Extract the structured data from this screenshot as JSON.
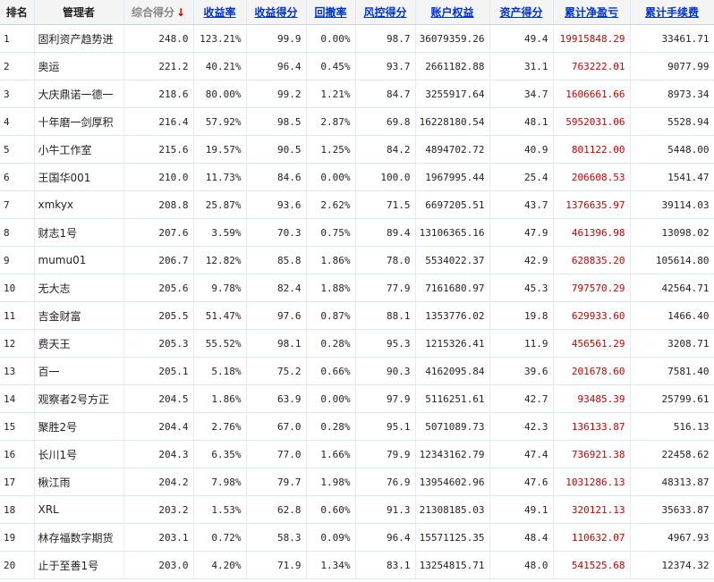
{
  "table": {
    "headers": [
      {
        "label": "排名",
        "key": "rank"
      },
      {
        "label": "管理者",
        "key": "manager"
      },
      {
        "label": "综合得分",
        "key": "composite",
        "sorted": true,
        "sort_arrow": "↓"
      },
      {
        "label": "收益率",
        "key": "return_rate"
      },
      {
        "label": "收益得分",
        "key": "return_score"
      },
      {
        "label": "回撤率",
        "key": "drawdown"
      },
      {
        "label": "风控得分",
        "key": "risk_score"
      },
      {
        "label": "账户权益",
        "key": "equity"
      },
      {
        "label": "资产得分",
        "key": "asset_score"
      },
      {
        "label": "累计净盈亏",
        "key": "net_pl"
      },
      {
        "label": "累计手续费",
        "key": "fees"
      }
    ],
    "rows": [
      {
        "rank": "1",
        "manager": "固利资产趋势进",
        "composite": "248.0",
        "return_rate": "123.21%",
        "return_score": "99.9",
        "drawdown": "0.00%",
        "risk_score": "98.7",
        "equity": "36079359.26",
        "asset_score": "49.4",
        "net_pl": "19915848.29",
        "fees": "33461.71"
      },
      {
        "rank": "2",
        "manager": "奥运",
        "composite": "221.2",
        "return_rate": "40.21%",
        "return_score": "96.4",
        "drawdown": "0.45%",
        "risk_score": "93.7",
        "equity": "2661182.88",
        "asset_score": "31.1",
        "net_pl": "763222.01",
        "fees": "9077.99"
      },
      {
        "rank": "3",
        "manager": "大庆鼎诺一德一",
        "composite": "218.6",
        "return_rate": "80.00%",
        "return_score": "99.2",
        "drawdown": "1.21%",
        "risk_score": "84.7",
        "equity": "3255917.64",
        "asset_score": "34.7",
        "net_pl": "1606661.66",
        "fees": "8973.34"
      },
      {
        "rank": "4",
        "manager": "十年磨一剑厚积",
        "composite": "216.4",
        "return_rate": "57.92%",
        "return_score": "98.5",
        "drawdown": "2.87%",
        "risk_score": "69.8",
        "equity": "16228180.54",
        "asset_score": "48.1",
        "net_pl": "5952031.06",
        "fees": "5528.94"
      },
      {
        "rank": "5",
        "manager": "小牛工作室",
        "composite": "215.6",
        "return_rate": "19.57%",
        "return_score": "90.5",
        "drawdown": "1.25%",
        "risk_score": "84.2",
        "equity": "4894702.72",
        "asset_score": "40.9",
        "net_pl": "801122.00",
        "fees": "5448.00"
      },
      {
        "rank": "6",
        "manager": "王国华001",
        "composite": "210.0",
        "return_rate": "11.73%",
        "return_score": "84.6",
        "drawdown": "0.00%",
        "risk_score": "100.0",
        "equity": "1967995.44",
        "asset_score": "25.4",
        "net_pl": "206608.53",
        "fees": "1541.47"
      },
      {
        "rank": "7",
        "manager": "xmkyx",
        "composite": "208.8",
        "return_rate": "25.87%",
        "return_score": "93.6",
        "drawdown": "2.62%",
        "risk_score": "71.5",
        "equity": "6697205.51",
        "asset_score": "43.7",
        "net_pl": "1376635.97",
        "fees": "39114.03"
      },
      {
        "rank": "8",
        "manager": "财志1号",
        "composite": "207.6",
        "return_rate": "3.59%",
        "return_score": "70.3",
        "drawdown": "0.75%",
        "risk_score": "89.4",
        "equity": "13106365.16",
        "asset_score": "47.9",
        "net_pl": "461396.98",
        "fees": "13098.02"
      },
      {
        "rank": "9",
        "manager": "mumu01",
        "composite": "206.7",
        "return_rate": "12.82%",
        "return_score": "85.8",
        "drawdown": "1.86%",
        "risk_score": "78.0",
        "equity": "5534022.37",
        "asset_score": "42.9",
        "net_pl": "628835.20",
        "fees": "105614.80"
      },
      {
        "rank": "10",
        "manager": "无大志",
        "composite": "205.6",
        "return_rate": "9.78%",
        "return_score": "82.4",
        "drawdown": "1.88%",
        "risk_score": "77.9",
        "equity": "7161680.97",
        "asset_score": "45.3",
        "net_pl": "797570.29",
        "fees": "42564.71"
      },
      {
        "rank": "11",
        "manager": "吉金财富",
        "composite": "205.5",
        "return_rate": "51.47%",
        "return_score": "97.6",
        "drawdown": "0.87%",
        "risk_score": "88.1",
        "equity": "1353776.02",
        "asset_score": "19.8",
        "net_pl": "629933.60",
        "fees": "1466.40"
      },
      {
        "rank": "12",
        "manager": "费天王",
        "composite": "205.3",
        "return_rate": "55.52%",
        "return_score": "98.1",
        "drawdown": "0.28%",
        "risk_score": "95.3",
        "equity": "1215326.41",
        "asset_score": "11.9",
        "net_pl": "456561.29",
        "fees": "3208.71"
      },
      {
        "rank": "13",
        "manager": "百一",
        "composite": "205.1",
        "return_rate": "5.18%",
        "return_score": "75.2",
        "drawdown": "0.66%",
        "risk_score": "90.3",
        "equity": "4162095.84",
        "asset_score": "39.6",
        "net_pl": "201678.60",
        "fees": "7581.40"
      },
      {
        "rank": "14",
        "manager": "观察者2号方正",
        "composite": "204.5",
        "return_rate": "1.86%",
        "return_score": "63.9",
        "drawdown": "0.00%",
        "risk_score": "97.9",
        "equity": "5116251.61",
        "asset_score": "42.7",
        "net_pl": "93485.39",
        "fees": "25799.61"
      },
      {
        "rank": "15",
        "manager": "聚胜2号",
        "composite": "204.4",
        "return_rate": "2.76%",
        "return_score": "67.0",
        "drawdown": "0.28%",
        "risk_score": "95.1",
        "equity": "5071089.73",
        "asset_score": "42.3",
        "net_pl": "136133.87",
        "fees": "516.13"
      },
      {
        "rank": "16",
        "manager": "长川1号",
        "composite": "204.3",
        "return_rate": "6.35%",
        "return_score": "77.0",
        "drawdown": "1.66%",
        "risk_score": "79.9",
        "equity": "12343162.79",
        "asset_score": "47.4",
        "net_pl": "736921.38",
        "fees": "22458.62"
      },
      {
        "rank": "17",
        "manager": "楸江雨",
        "composite": "204.2",
        "return_rate": "7.98%",
        "return_score": "79.7",
        "drawdown": "1.98%",
        "risk_score": "76.9",
        "equity": "13954602.96",
        "asset_score": "47.6",
        "net_pl": "1031286.13",
        "fees": "48313.87"
      },
      {
        "rank": "18",
        "manager": "XRL",
        "composite": "203.2",
        "return_rate": "1.53%",
        "return_score": "62.8",
        "drawdown": "0.60%",
        "risk_score": "91.3",
        "equity": "21308185.03",
        "asset_score": "49.1",
        "net_pl": "320121.13",
        "fees": "35633.87"
      },
      {
        "rank": "19",
        "manager": "林存福数字期货",
        "composite": "203.1",
        "return_rate": "0.72%",
        "return_score": "58.3",
        "drawdown": "0.09%",
        "risk_score": "96.4",
        "equity": "15571125.35",
        "asset_score": "48.4",
        "net_pl": "110632.07",
        "fees": "4967.93"
      },
      {
        "rank": "20",
        "manager": "止于至善1号",
        "composite": "203.0",
        "return_rate": "4.20%",
        "return_score": "71.9",
        "drawdown": "1.34%",
        "risk_score": "83.1",
        "equity": "13254815.71",
        "asset_score": "48.0",
        "net_pl": "541525.68",
        "fees": "12374.32"
      }
    ]
  },
  "colors": {
    "header_link": "#0033cc",
    "header_active": "#888888",
    "sort_arrow": "#cc0000",
    "profit": "#cc0000",
    "grid": "#dfe6ee"
  }
}
